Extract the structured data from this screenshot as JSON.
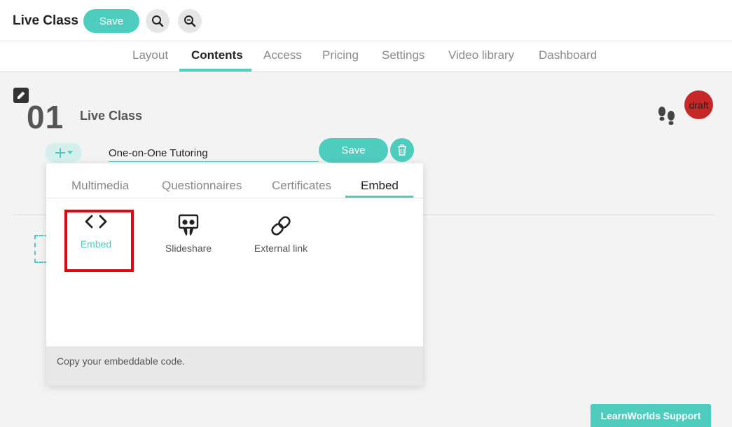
{
  "header": {
    "title": "Live Class",
    "save_label": "Save",
    "icons": [
      "search-icon",
      "zoom-out-icon"
    ]
  },
  "tabs": [
    {
      "label": "Layout",
      "active": false
    },
    {
      "label": "Contents",
      "active": true
    },
    {
      "label": "Access",
      "active": false
    },
    {
      "label": "Pricing",
      "active": false
    },
    {
      "label": "Settings",
      "active": false
    },
    {
      "label": "Video library",
      "active": false
    },
    {
      "label": "Dashboard",
      "active": false
    }
  ],
  "section": {
    "number": "01",
    "title": "Live Class",
    "status_badge": "draft"
  },
  "item_row": {
    "name_value": "One-on-One Tutoring",
    "save_label": "Save"
  },
  "popup": {
    "tabs": [
      "Multimedia",
      "Questionnaires",
      "Certificates",
      "Embed"
    ],
    "active_tab": "Embed",
    "options": [
      {
        "label": "Embed",
        "icon": "code-icon",
        "selected": true
      },
      {
        "label": "Slideshare",
        "icon": "slideshare-icon",
        "selected": false
      },
      {
        "label": "External link",
        "icon": "link-icon",
        "selected": false
      }
    ],
    "footer_text": "Copy your embeddable code."
  },
  "support_button": "LearnWorlds Support",
  "colors": {
    "accent": "#4ecdbf",
    "draft": "#c62828",
    "highlight": "#e8000b"
  }
}
